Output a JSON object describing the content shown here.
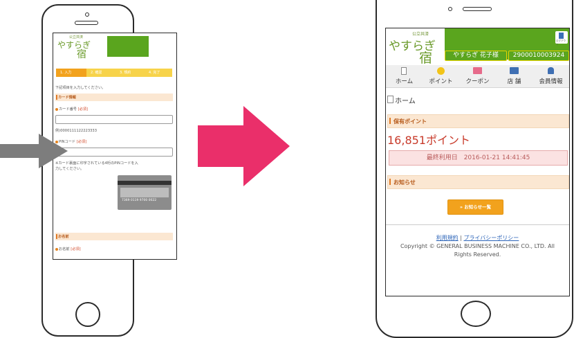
{
  "left_phone": {
    "logo_small": "公立共済",
    "logo_main": "やすらぎ",
    "logo_circle": "の",
    "logo_kanji": "宿",
    "steps": [
      "1. 入力",
      "2. 確認",
      "3. 規約",
      "4. 完了"
    ],
    "instruction": "下記項目を入力してください。",
    "section_card": "カード情報",
    "card_number_label": "カード番号",
    "required": "[必須]",
    "card_number_example": "例)0000111122223333",
    "pin_label": "PINコード",
    "pin_note_line1": "※カード裏面に印字されている4桁のPINコードを入",
    "pin_note_line2": "力してください。",
    "card_numbers": "7369 0119 9700 0022",
    "section_name": "お名前",
    "name_label": "お名前"
  },
  "right_phone": {
    "logo_small": "公立共済",
    "logo_main": "やすらぎ",
    "logo_circle": "の",
    "logo_kanji": "宿",
    "logout_label": "ログアウト",
    "user_name": "やすらぎ 花子様",
    "member_number": "2900010003924",
    "nav": [
      {
        "label": "ホーム",
        "icon": "home-icon"
      },
      {
        "label": "ポイント",
        "icon": "point-coin-icon"
      },
      {
        "label": "クーポン",
        "icon": "coupon-icon"
      },
      {
        "label": "店 舗",
        "icon": "store-icon"
      },
      {
        "label": "会員情報",
        "icon": "member-icon"
      }
    ],
    "page_title": "ホーム",
    "section_points": "保有ポイント",
    "points": "16,851ポイント",
    "last_used": "最終利用日　2016-01-21 14:41:45",
    "section_news": "お知らせ",
    "news_button": "» お知らせ一覧",
    "link_terms": "利用規約",
    "link_separator": " | ",
    "link_privacy": "プライバシーポリシー",
    "copyright_line1": "Copyright © GENERAL BUSINESS MACHINE CO., LTD. All",
    "copyright_line2": "Rights Reserved."
  },
  "colors": {
    "green": "#5aa51e",
    "pink_arrow": "#ea2f6a",
    "gray_arrow": "#7d7d7d",
    "orange": "#f2a21d",
    "step_active": "#f2a21d",
    "step_inactive": "#f7d34a"
  }
}
